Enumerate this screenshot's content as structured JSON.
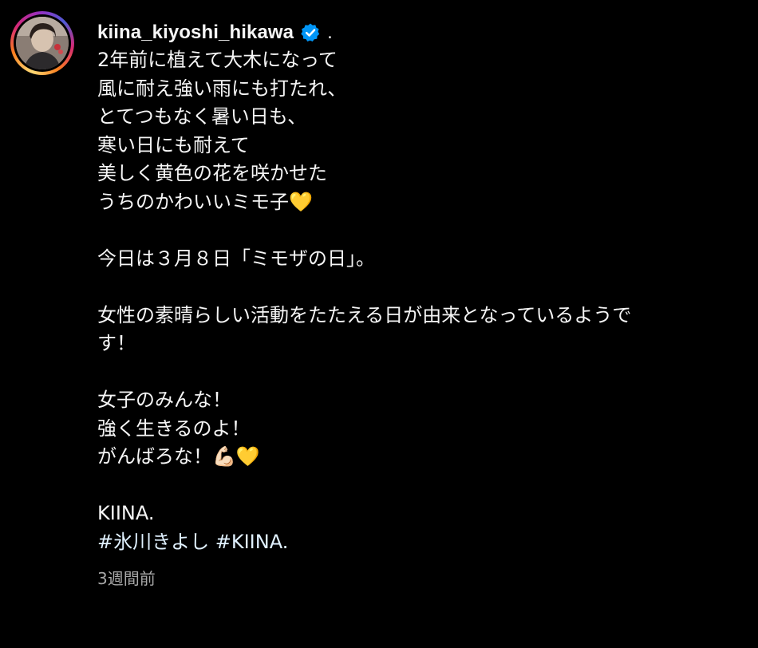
{
  "post": {
    "username": "kiina_kiyoshi_hikawa",
    "verified_icon": "verified-badge-icon",
    "separator": ".",
    "caption": "2年前に植えて大木になって\n風に耐え強い雨にも打たれ、\nとてつもなく暑い日も、\n寒い日にも耐えて\n美しく黄色の花を咲かせた\nうちのかわいいミモ子💛\n\n今日は３月８日「ミモザの日」。\n\n女性の素晴らしい活動をたたえる日が由来となっているようで\nす！\n\n女子のみんな！\n強く生きるのよ！\nがんばろな！💪🏻💛\n\nKIINA.\n",
    "hashtags": [
      "#氷川きよし",
      "#KIINA."
    ],
    "timestamp": "3週間前"
  },
  "colors": {
    "background": "#000000",
    "text": "#f5f5f5",
    "hashtag": "#e0f1ff",
    "muted": "#a8a8a8",
    "verified": "#0095f6"
  }
}
